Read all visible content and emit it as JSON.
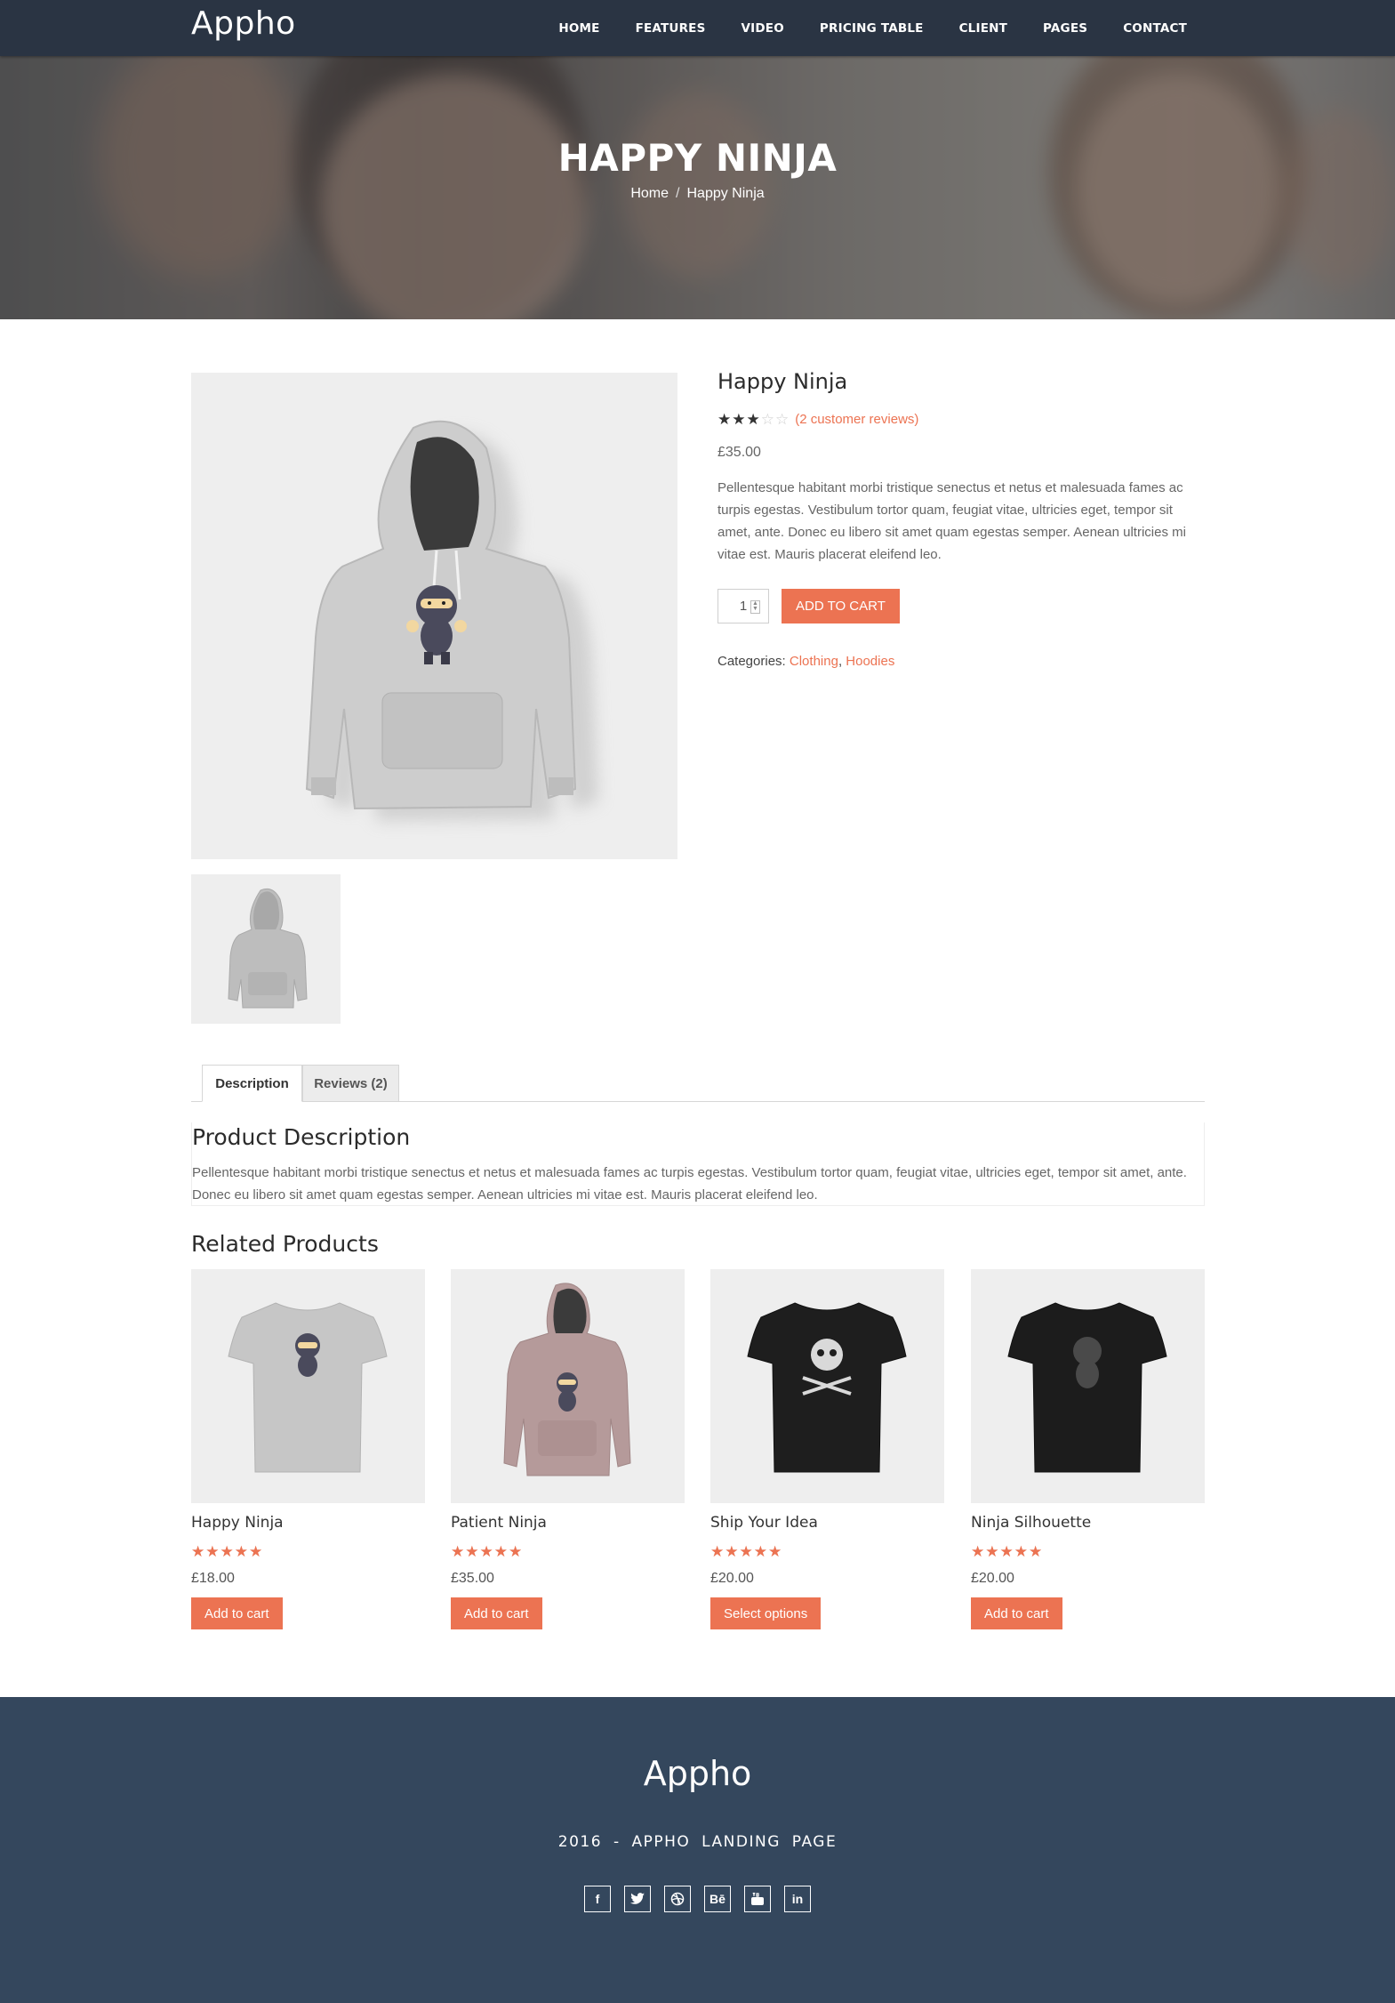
{
  "nav": {
    "logo": "Appho",
    "items": [
      "HOME",
      "FEATURES",
      "VIDEO",
      "PRICING TABLE",
      "CLIENT",
      "PAGES",
      "CONTACT"
    ]
  },
  "hero": {
    "title": "HAPPY NINJA",
    "breadcrumb": [
      "Home",
      "Happy Ninja"
    ],
    "separator": "/"
  },
  "product": {
    "title": "Happy Ninja",
    "rating": 3,
    "rating_max": 5,
    "reviews_link": "(2 customer reviews)",
    "price": "£35.00",
    "description": "Pellentesque habitant morbi tristique senectus et netus et malesuada fames ac turpis egestas. Vestibulum tortor quam, feugiat vitae, ultricies eget, tempor sit amet, ante. Donec eu libero sit amet quam egestas semper. Aenean ultricies mi vitae est. Mauris placerat eleifend leo.",
    "quantity": "1",
    "add_to_cart": "ADD TO CART",
    "categories_label": "Categories:",
    "categories": [
      "Clothing",
      "Hoodies"
    ],
    "categories_sep": ","
  },
  "tabs": {
    "items": [
      "Description",
      "Reviews (2)"
    ],
    "active": "Description",
    "panel_title": "Product Description",
    "panel_text": "Pellentesque habitant morbi tristique senectus et netus et malesuada fames ac turpis egestas. Vestibulum tortor quam, feugiat vitae, ultricies eget, tempor sit amet, ante. Donec eu libero sit amet quam egestas semper. Aenean ultricies mi vitae est. Mauris placerat eleifend leo."
  },
  "related": {
    "title": "Related Products",
    "products": [
      {
        "name": "Happy Ninja",
        "rating": 5,
        "price": "£18.00",
        "button": "Add to cart"
      },
      {
        "name": "Patient Ninja",
        "rating": 5,
        "price": "£35.00",
        "button": "Add to cart"
      },
      {
        "name": "Ship Your Idea",
        "rating": 4.5,
        "price": "£20.00",
        "button": "Select options"
      },
      {
        "name": "Ninja Silhouette",
        "rating": 5,
        "price": "£20.00",
        "button": "Add to cart"
      }
    ]
  },
  "footer": {
    "logo": "Appho",
    "tagline": "2016 - APPHO LANDING PAGE",
    "socials": [
      {
        "icon": "facebook-icon",
        "glyph": "f"
      },
      {
        "icon": "twitter-icon",
        "glyph": ""
      },
      {
        "icon": "dribbble-icon",
        "glyph": ""
      },
      {
        "icon": "behance-icon",
        "glyph": "Bē"
      },
      {
        "icon": "youtube-icon",
        "glyph": ""
      },
      {
        "icon": "linkedin-icon",
        "glyph": "in"
      }
    ]
  },
  "colors": {
    "accent": "#ec7352",
    "nav_bg": "#2a3443",
    "footer_bg": "#34475d",
    "product_bg": "#eeeeee"
  }
}
